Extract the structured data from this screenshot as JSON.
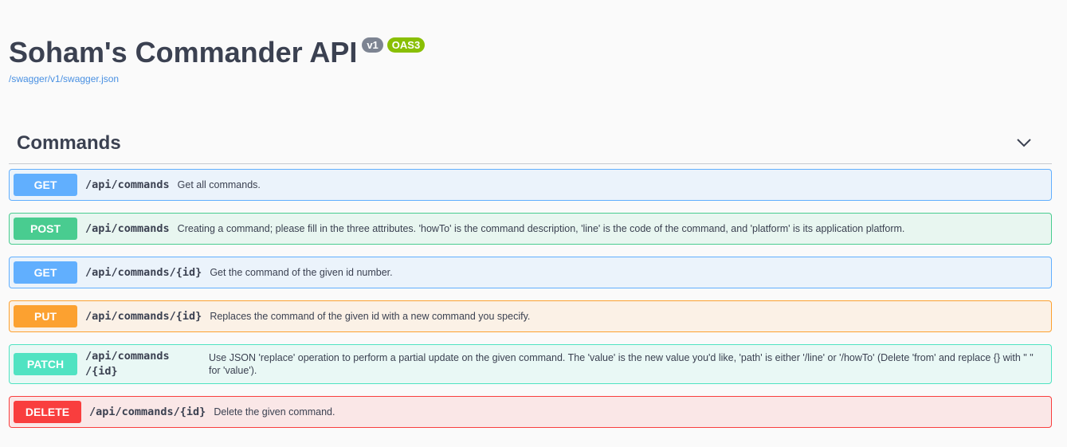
{
  "info": {
    "title": "Soham's Commander API",
    "version_badge": "v1",
    "oas_badge": "OAS3",
    "spec_link": "/swagger/v1/swagger.json"
  },
  "section": {
    "title": "Commands",
    "toggle_icon": "chevron-down-icon"
  },
  "operations": [
    {
      "method": "GET",
      "path": "/api/commands",
      "summary": "Get all commands."
    },
    {
      "method": "POST",
      "path": "/api/commands",
      "summary": "Creating a command; please fill in the three attributes. 'howTo' is the command description, 'line' is the code of the command, and 'platform' is its application platform."
    },
    {
      "method": "GET",
      "path": "/api/commands/{id}",
      "summary": "Get the command of the given id number."
    },
    {
      "method": "PUT",
      "path": "/api/commands/{id}",
      "summary": "Replaces the command of the given id with a new command you specify."
    },
    {
      "method": "PATCH",
      "path": "/api/commands\n/{id}",
      "path_line1": "/api/commands",
      "path_line2": "/{id}",
      "summary": "Use JSON 'replace' operation to perform a partial update on the given command. The 'value' is the new value you'd like, 'path' is either '/line' or '/howTo' (Delete 'from' and replace {} with \" \" for 'value')."
    },
    {
      "method": "DELETE",
      "path": "/api/commands/{id}",
      "summary": "Delete the given command."
    }
  ],
  "colors": {
    "get": "#61affe",
    "post": "#49cc90",
    "put": "#fca130",
    "patch": "#50e3c2",
    "delete": "#f93e3e"
  }
}
